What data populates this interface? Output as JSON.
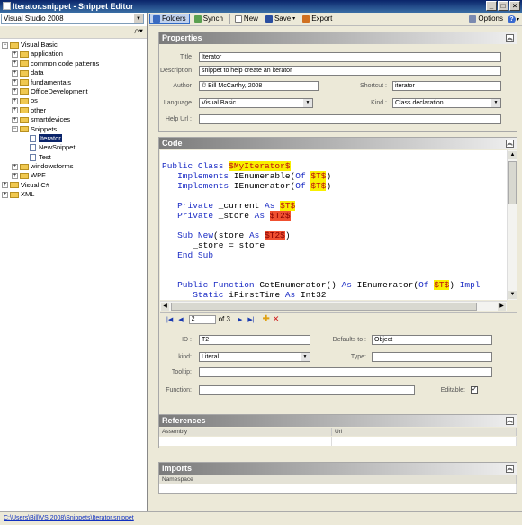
{
  "window": {
    "title": "Iterator.snippet - Snippet Editor",
    "controls": [
      "_",
      "□",
      "×"
    ]
  },
  "left": {
    "version_combo": "Visual Studio 2008",
    "tree": [
      {
        "level": 0,
        "toggle": "−",
        "type": "folder",
        "label": "Visual Basic"
      },
      {
        "level": 1,
        "toggle": "+",
        "type": "folder",
        "label": "application"
      },
      {
        "level": 1,
        "toggle": "+",
        "type": "folder",
        "label": "common code patterns"
      },
      {
        "level": 1,
        "toggle": "+",
        "type": "folder",
        "label": "data"
      },
      {
        "level": 1,
        "toggle": "+",
        "type": "folder",
        "label": "fundamentals"
      },
      {
        "level": 1,
        "toggle": "+",
        "type": "folder",
        "label": "OfficeDevelopment"
      },
      {
        "level": 1,
        "toggle": "+",
        "type": "folder",
        "label": "os"
      },
      {
        "level": 1,
        "toggle": "+",
        "type": "folder",
        "label": "other"
      },
      {
        "level": 1,
        "toggle": "+",
        "type": "folder",
        "label": "smartdevices"
      },
      {
        "level": 1,
        "toggle": "−",
        "type": "folder",
        "label": "Snippets"
      },
      {
        "level": 2,
        "toggle": "",
        "type": "doc",
        "label": "Iterator",
        "selected": true
      },
      {
        "level": 2,
        "toggle": "",
        "type": "doc",
        "label": "NewSnippet"
      },
      {
        "level": 2,
        "toggle": "",
        "type": "doc",
        "label": "Test"
      },
      {
        "level": 1,
        "toggle": "+",
        "type": "folder",
        "label": "windowsforms"
      },
      {
        "level": 1,
        "toggle": "+",
        "type": "folder",
        "label": "WPF"
      },
      {
        "level": 0,
        "toggle": "+",
        "type": "folder",
        "label": "Visual C#"
      },
      {
        "level": 0,
        "toggle": "+",
        "type": "folder",
        "label": "XML"
      }
    ]
  },
  "toolbar": {
    "folders": "Folders",
    "synch": "Synch",
    "new": "New",
    "save": "Save",
    "export": "Export",
    "options": "Options"
  },
  "properties": {
    "heading": "Properties",
    "title_label": "Title",
    "title_value": "Iterator",
    "description_label": "Description",
    "description_value": "snippet to help create an iterator",
    "author_label": "Author",
    "author_value": "© Bill McCarthy, 2008",
    "shortcut_label": "Shortcut :",
    "shortcut_value": "iterator",
    "language_label": "Language",
    "language_value": "Visual Basic",
    "kind_label": "Kind :",
    "kind_value": "Class declaration",
    "helpurl_label": "Help Url :",
    "helpurl_value": ""
  },
  "code": {
    "heading": "Code"
  },
  "literal": {
    "page": "2",
    "of": "of 3",
    "id_label": "ID :",
    "id_value": "T2",
    "defaults_label": "Defaults to :",
    "defaults_value": "Object",
    "kind_label": "kind:",
    "kind_value": "Literal",
    "type_label": "Type:",
    "type_value": "",
    "tooltip_label": "Tooltip:",
    "tooltip_value": "",
    "function_label": "Function:",
    "function_value": "",
    "editable_label": "Editable:",
    "editable_checked": "✓"
  },
  "references": {
    "heading": "References",
    "col1": "Assembly",
    "col2": "Url"
  },
  "imports": {
    "heading": "Imports",
    "col1": "Namespace"
  },
  "status": {
    "path": "C:\\Users\\Bill\\VS 2008\\Snippets\\Iterator.snippet"
  }
}
